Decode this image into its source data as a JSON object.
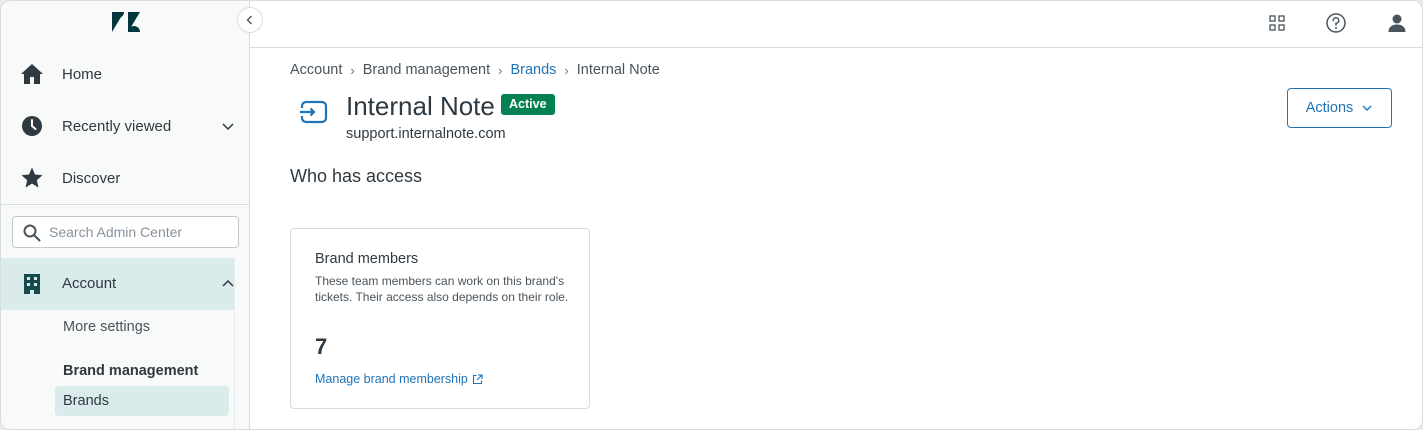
{
  "sidebar": {
    "logo": "zendesk-logo",
    "nav": [
      {
        "label": "Home",
        "icon": "home-icon"
      },
      {
        "label": "Recently viewed",
        "icon": "clock-icon"
      },
      {
        "label": "Discover",
        "icon": "star-icon"
      }
    ],
    "search": {
      "placeholder": "Search Admin Center",
      "value": ""
    },
    "account": {
      "label": "Account",
      "icon": "building-icon",
      "expanded": true,
      "sub_items": {
        "more_settings": "More settings",
        "brand_management": "Brand management",
        "brands": "Brands"
      }
    }
  },
  "topbar": {
    "icons": [
      "apps-grid-icon",
      "help-icon",
      "user-icon"
    ]
  },
  "breadcrumb": [
    "Account",
    "Brand management",
    "Brands",
    "Internal Note"
  ],
  "brand": {
    "name": "Internal Note",
    "status": "Active",
    "url": "support.internalnote.com"
  },
  "actions_label": "Actions",
  "access_section": {
    "title": "Who has access",
    "card": {
      "title": "Brand members",
      "description": "These team members can work on this brand's tickets. Their access also depends on their role.",
      "count": "7",
      "link": "Manage brand membership"
    }
  },
  "colors": {
    "accent": "#1f73b7",
    "active_badge": "#038153",
    "sidebar_selected": "#d9ebea"
  }
}
